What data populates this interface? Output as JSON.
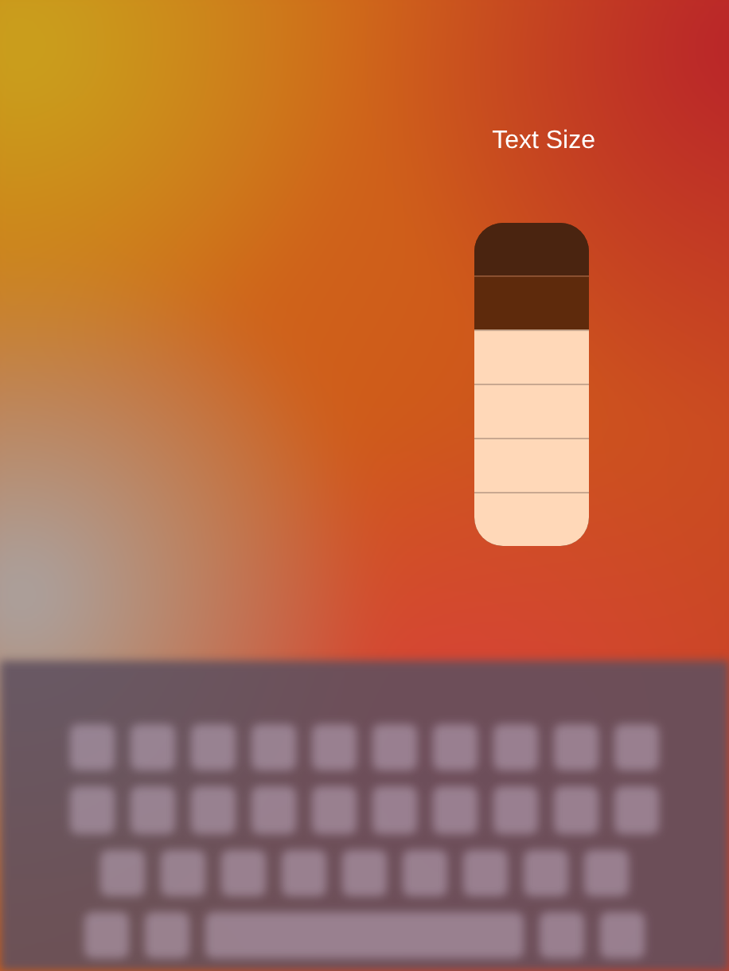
{
  "text_size": {
    "title": "Text Size",
    "segments": [
      {
        "filled": false
      },
      {
        "filled": false
      },
      {
        "filled": true
      },
      {
        "filled": true
      },
      {
        "filled": true
      },
      {
        "filled": true
      }
    ]
  }
}
